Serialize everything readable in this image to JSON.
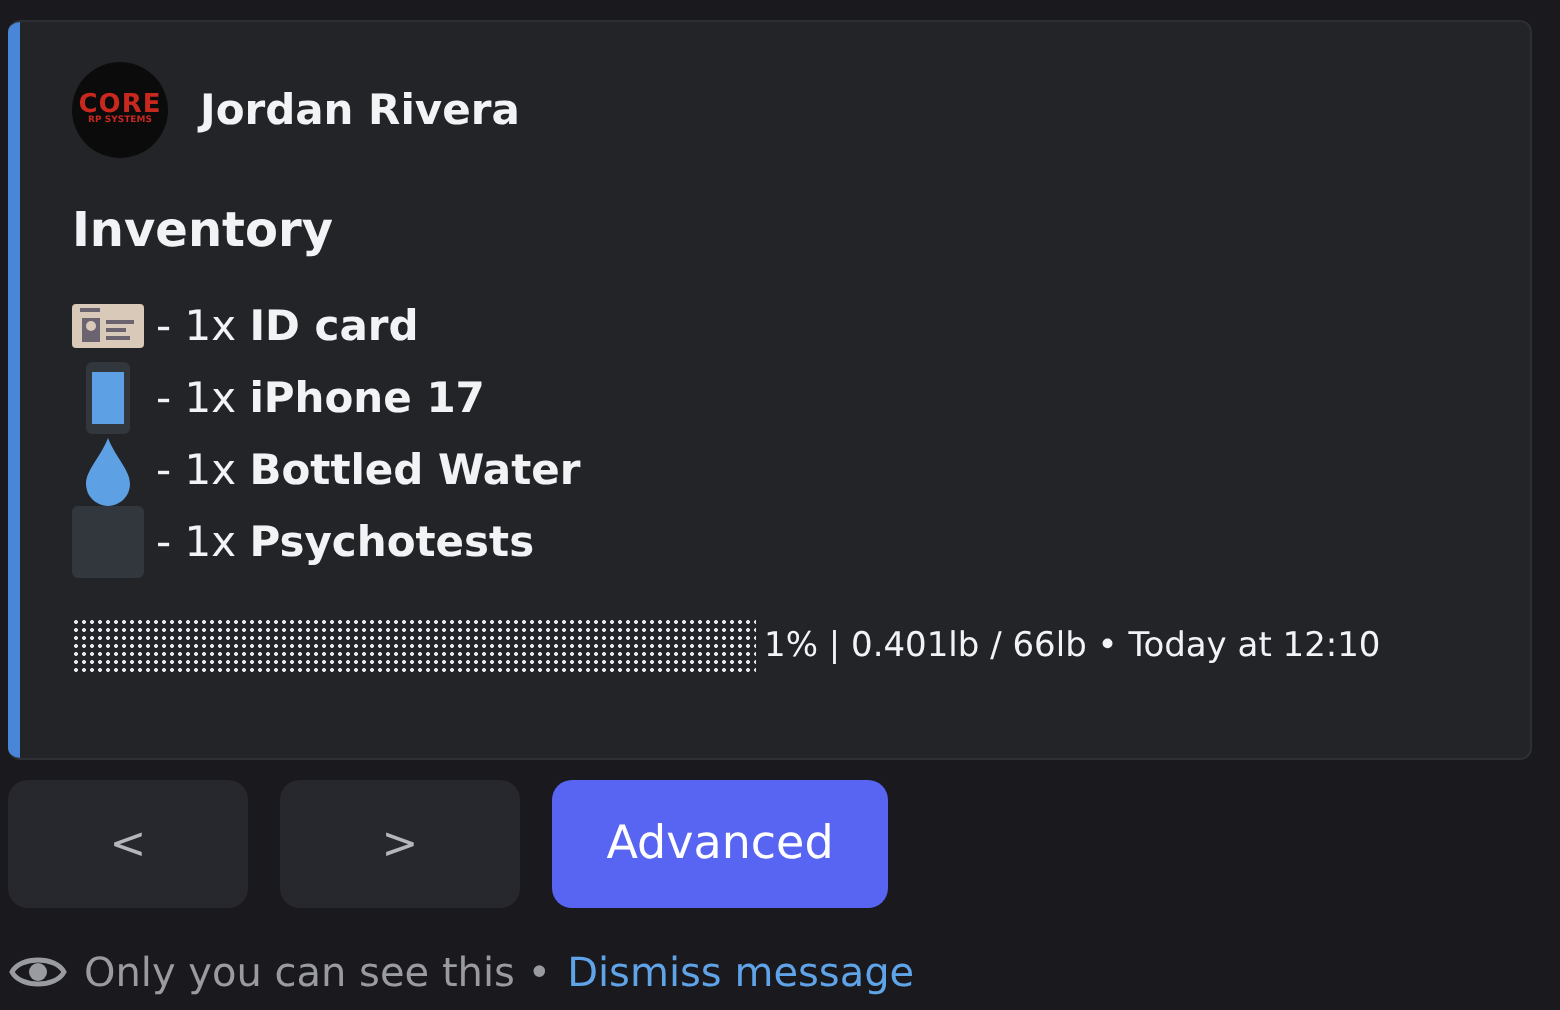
{
  "embed": {
    "color": "#4a86d8",
    "author": {
      "logo_top": "CORE",
      "logo_bottom": "RP SYSTEMS",
      "name": "Jordan Rivera"
    },
    "title": "Inventory",
    "items": [
      {
        "kind": "id-card",
        "text": "- 1x **ID card**"
      },
      {
        "kind": "phone",
        "text": "- 1x **iPhone 17**"
      },
      {
        "kind": "drop",
        "text": "- 1x **Bottled Water**"
      },
      {
        "kind": "blank",
        "text": "- 1x **Psychotests**"
      }
    ],
    "footer": "1% | 0.401lb / 66lb • Today at 12:10"
  },
  "buttons": [
    {
      "label": "<",
      "kind": "secondary"
    },
    {
      "label": ">",
      "kind": "secondary"
    },
    {
      "label": "Advanced",
      "kind": "primary"
    }
  ],
  "notice": {
    "text": "Only you can see this •",
    "link": "Dismiss message"
  }
}
